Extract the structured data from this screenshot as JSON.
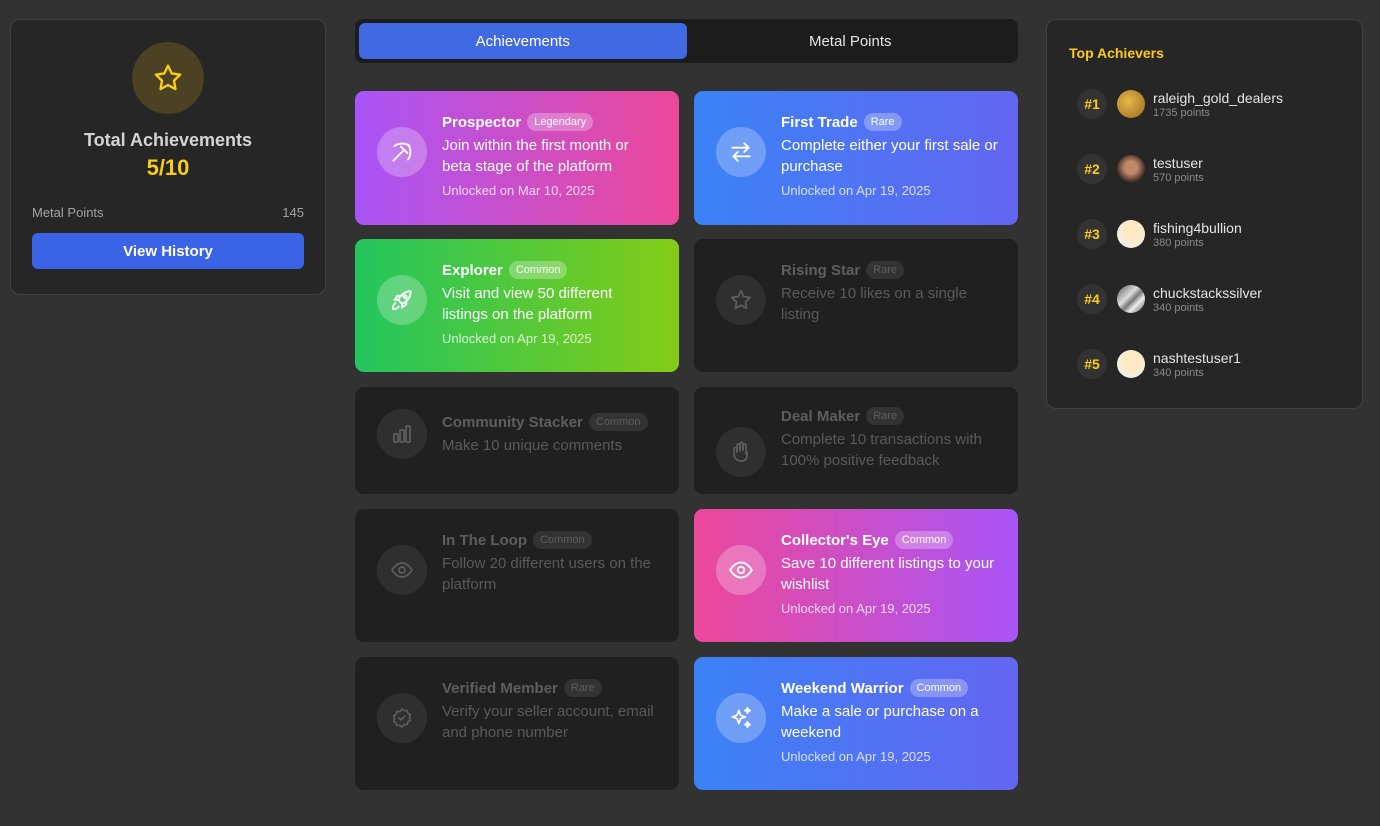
{
  "summary": {
    "title": "Total Achievements",
    "count": "5/10",
    "metal_label": "Metal Points",
    "metal_value": "145",
    "history_button": "View History"
  },
  "tabs": [
    {
      "label": "Achievements",
      "active": true
    },
    {
      "label": "Metal Points",
      "active": false
    }
  ],
  "achievements": [
    {
      "title": "Prospector",
      "badge": "Legendary",
      "desc": "Join within the first month or beta stage of the platform",
      "date": "Unlocked on Mar 10, 2025",
      "icon": "pickaxe-icon",
      "unlocked": true
    },
    {
      "title": "First Trade",
      "badge": "Rare",
      "desc": "Complete either your first sale or purchase",
      "date": "Unlocked on Apr 19, 2025",
      "icon": "swap-arrows-icon",
      "unlocked": true
    },
    {
      "title": "Explorer",
      "badge": "Common",
      "desc": "Visit and view 50 different listings on the platform",
      "date": "Unlocked on Apr 19, 2025",
      "icon": "rocket-icon",
      "unlocked": true
    },
    {
      "title": "Rising Star",
      "badge": "Rare",
      "desc": "Receive 10 likes on a single listing",
      "date": "",
      "icon": "star-icon",
      "unlocked": false
    },
    {
      "title": "Community Stacker",
      "badge": "Common",
      "desc": "Make 10 unique comments",
      "date": "",
      "icon": "bar-chart-icon",
      "unlocked": false
    },
    {
      "title": "Deal Maker",
      "badge": "Rare",
      "desc": "Complete 10 transactions with 100% positive feedback",
      "date": "",
      "icon": "hand-icon",
      "unlocked": false
    },
    {
      "title": "In The Loop",
      "badge": "Common",
      "desc": "Follow 20 different users on the platform",
      "date": "",
      "icon": "eye-icon",
      "unlocked": false
    },
    {
      "title": "Collector's Eye",
      "badge": "Common",
      "desc": "Save 10 different listings to your wishlist",
      "date": "Unlocked on Apr 19, 2025",
      "icon": "eye-icon",
      "unlocked": true
    },
    {
      "title": "Verified Member",
      "badge": "Rare",
      "desc": "Verify your seller account, email and phone number",
      "date": "",
      "icon": "verified-badge-icon",
      "unlocked": false
    },
    {
      "title": "Weekend Warrior",
      "badge": "Common",
      "desc": "Make a sale or purchase on a weekend",
      "date": "Unlocked on Apr 19, 2025",
      "icon": "sparkles-icon",
      "unlocked": true
    }
  ],
  "leaders": {
    "title": "Top Achievers",
    "items": [
      {
        "rank": "#1",
        "name": "raleigh_gold_dealers",
        "points": "1735 points"
      },
      {
        "rank": "#2",
        "name": "testuser",
        "points": "570 points"
      },
      {
        "rank": "#3",
        "name": "fishing4bullion",
        "points": "380 points"
      },
      {
        "rank": "#4",
        "name": "chuckstackssilver",
        "points": "340 points"
      },
      {
        "rank": "#5",
        "name": "nashtestuser1",
        "points": "340 points"
      }
    ]
  },
  "colors": {
    "accent_blue": "#4169e1",
    "gold": "#facc15",
    "background": "#323232",
    "card_locked": "#202020"
  }
}
